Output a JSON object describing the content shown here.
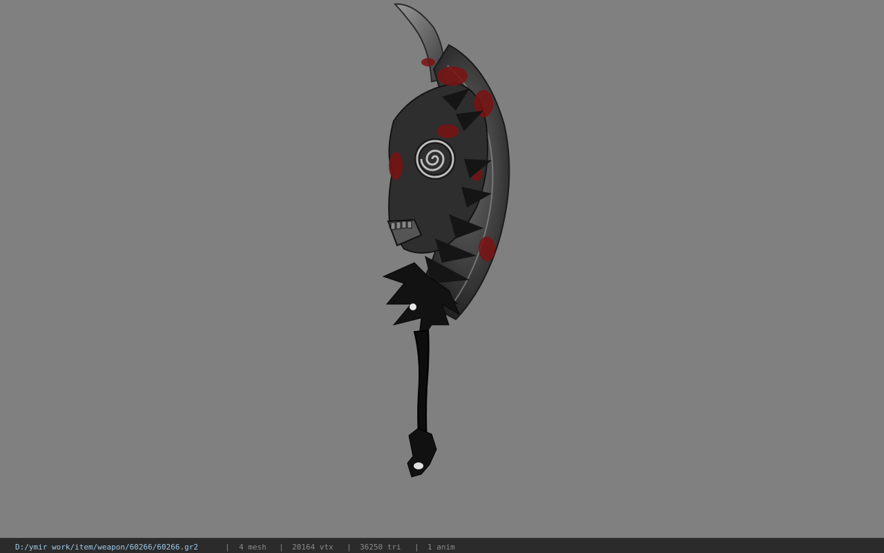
{
  "viewer": {
    "background_color": "#808080",
    "model_icon": "axe-weapon-model"
  },
  "statusbar": {
    "file_path": "D:/ymir work/item/weapon/60266/60266.gr2",
    "separator": "|",
    "mesh_count": "4 mesh",
    "vertex_count": "20164 vtx",
    "triangle_count": "36250 tri",
    "anim_count": "1 anim"
  }
}
